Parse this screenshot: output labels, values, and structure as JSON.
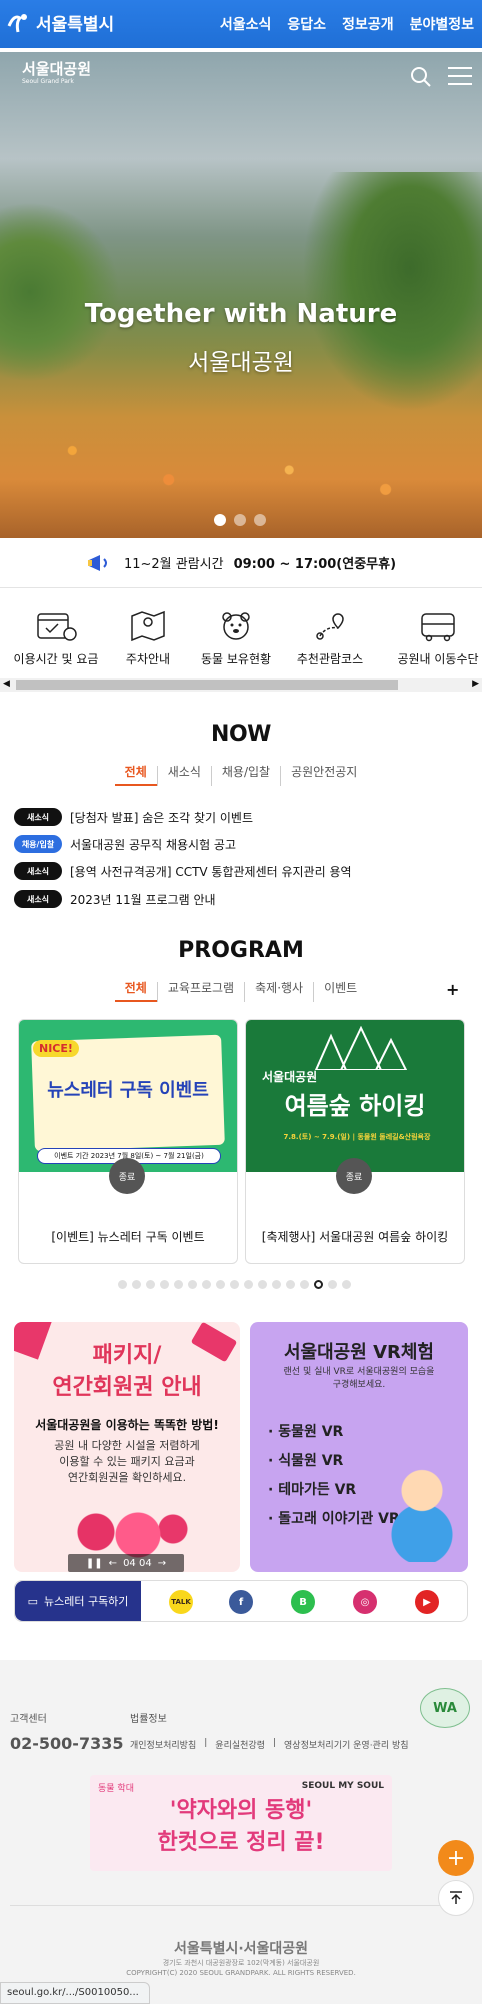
{
  "topbar": {
    "brand": "서울특별시",
    "nav": [
      "서울소식",
      "응답소",
      "정보공개",
      "분야별정보"
    ]
  },
  "hero": {
    "logo": "서울대공원",
    "logo_sub": "Seoul Grand Park",
    "headline": "Together with Nature",
    "subheadline": "서울대공원",
    "slides": 3,
    "active_slide": 0
  },
  "hours": {
    "label": "11~2월 관람시간",
    "time": "09:00 ~ 17:00(연중무휴)"
  },
  "quick": [
    "이용시간 및 요금",
    "주차안내",
    "동물 보유현황",
    "추천관람코스",
    "공원내 이동수단"
  ],
  "now": {
    "title": "NOW",
    "tabs": [
      "전체",
      "새소식",
      "채용/입찰",
      "공원안전공지"
    ],
    "items": [
      {
        "badge": "새소식",
        "text": "[당첨자 발표] 숨은 조각 찾기 이벤트"
      },
      {
        "badge": "채용/입찰",
        "text": "서울대공원 공무직 채용시험 공고"
      },
      {
        "badge": "새소식",
        "text": "[용역 사전규격공개] CCTV 통합관제센터 유지관리 용역"
      },
      {
        "badge": "새소식",
        "text": "2023년 11월 프로그램 안내"
      }
    ]
  },
  "program": {
    "title": "PROGRAM",
    "tabs": [
      "전체",
      "교육프로그램",
      "축제·행사",
      "이벤트"
    ],
    "more": "+",
    "cards": [
      {
        "caption": "[이벤트] 뉴스레터 구독 이벤트",
        "status": "종료",
        "img_title": "뉴스레터 구독 이벤트",
        "img_tag": "NICE!",
        "img_period": "이벤트 기간  2023년 7월 8일(토) ~ 7월 21일(금)"
      },
      {
        "caption": "[축제행사] 서울대공원 여름숲 하이킹",
        "status": "종료",
        "img_title": "여름숲 하이킹",
        "img_sub": "서울대공원",
        "img_period": "7.8.(토) ~ 7.9.(일) | 동물원 둘레길&산림욕장"
      }
    ],
    "dots": 17,
    "active_dot": 14
  },
  "package": {
    "title1": "패키지/",
    "title2": "연간회원권 안내",
    "lead": "서울대공원을 이용하는 똑똑한 방법!",
    "body": [
      "공원 내 다양한 시설을 저렴하게",
      "이용할 수 있는 패키지 요금과",
      "연간회원권을 확인하세요."
    ],
    "pager": "04  04"
  },
  "vr": {
    "title": "서울대공원 VR체험",
    "desc": [
      "랜선 및 실내 VR로 서울대공원의 모습을",
      "구경해보세요."
    ],
    "items": [
      "· 동물원 VR",
      "· 식물원 VR",
      "· 테마가든 VR",
      "· 돌고래 이야기관 VR"
    ]
  },
  "social": {
    "newsletter": "뉴스레터 구독하기",
    "icons": [
      {
        "name": "kakao",
        "label": "TALK",
        "color": "#f9d71c"
      },
      {
        "name": "facebook",
        "label": "f",
        "color": "#3b5a9a"
      },
      {
        "name": "blog",
        "label": "B",
        "color": "#2dbf4f"
      },
      {
        "name": "instagram",
        "label": "◎",
        "color": "#d6306f"
      },
      {
        "name": "youtube",
        "label": "▶",
        "color": "#e22424"
      }
    ]
  },
  "footer": {
    "center_label": "고객센터",
    "phone": "02-500-7335",
    "law_label": "법률정보",
    "links": [
      "개인정보처리방침",
      "윤리실천강령",
      "영상정보처리기기 운영·관리 방침"
    ],
    "wa": "WA",
    "banner": {
      "tag1": "동물 학대 ",
      "tag2": "SEOUL MY SOUL",
      "text1": "'약자와의 동행'",
      "text2": "한컷으로 정리 끝!"
    },
    "logo": "서울특별시·서울대공원",
    "address": "경기도 과천시 대공원광장로 102(막계동) 서울대공원",
    "copyright": "COPYRIGHT(C) 2020 SEOUL GRANDPARK. ALL RIGHTS RESERVED."
  },
  "status_url": "seoul.go.kr/.../S0010050..."
}
